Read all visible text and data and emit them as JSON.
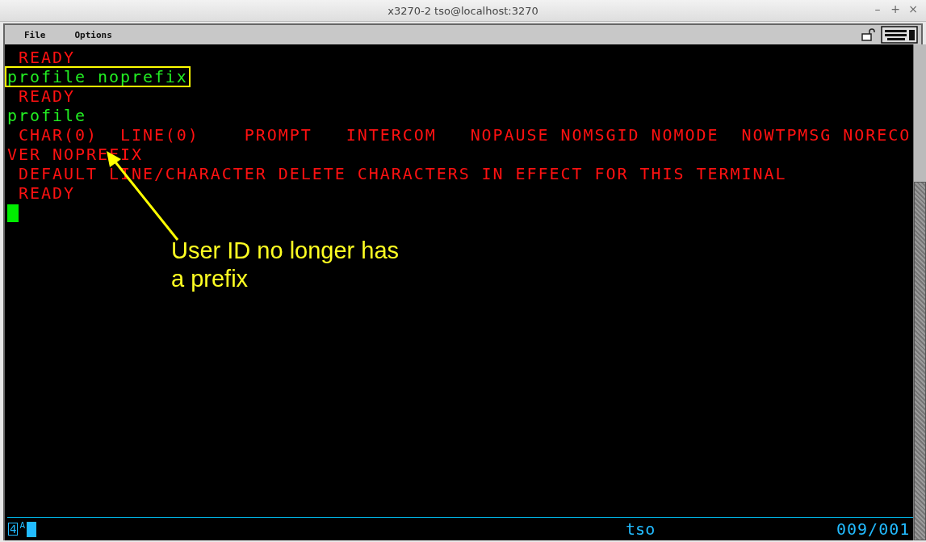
{
  "window": {
    "title": "x3270-2 tso@localhost:3270",
    "controls": [
      "–",
      "+",
      "×"
    ]
  },
  "menu": [
    {
      "label": "File"
    },
    {
      "label": "Options"
    }
  ],
  "terminal": {
    "lines": [
      {
        "text": " READY",
        "kind": "output",
        "highlighted": false
      },
      {
        "text": "profile noprefix",
        "kind": "input",
        "highlighted": true
      },
      {
        "text": " READY",
        "kind": "output",
        "highlighted": false
      },
      {
        "text": "profile",
        "kind": "input",
        "highlighted": false
      },
      {
        "text": " CHAR(0)  LINE(0)    PROMPT   INTERCOM   NOPAUSE NOMSGID NOMODE  NOWTPMSG NORECO",
        "kind": "output",
        "highlighted": false
      },
      {
        "text": "VER NOPREFIX",
        "kind": "output",
        "highlighted": false
      },
      {
        "text": " DEFAULT LINE/CHARACTER DELETE CHARACTERS IN EFFECT FOR THIS TERMINAL",
        "kind": "output",
        "highlighted": false
      },
      {
        "text": " READY",
        "kind": "output",
        "highlighted": false
      }
    ],
    "annotation": {
      "text": "User ID no longer has a prefix"
    }
  },
  "status_bar": {
    "connection": "4",
    "mode": "A",
    "lu_name": "tso",
    "cursor_position": "009/001"
  }
}
